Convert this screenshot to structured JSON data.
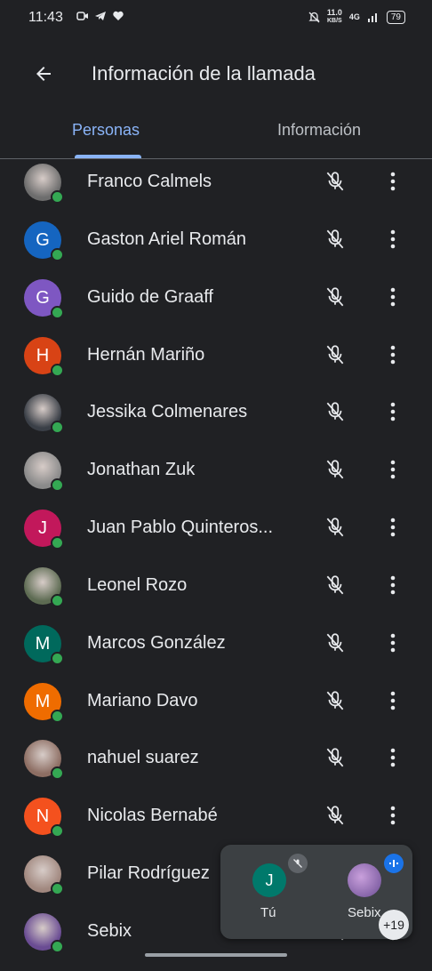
{
  "status_bar": {
    "time": "11:43",
    "net_speed_value": "11.0",
    "net_speed_unit": "KB/S",
    "network": "4G",
    "battery": "79"
  },
  "header": {
    "title": "Información de la llamada"
  },
  "tabs": [
    {
      "label": "Personas",
      "active": true
    },
    {
      "label": "Información",
      "active": false
    }
  ],
  "participants": [
    {
      "name": "Franco Calmels",
      "initial": "",
      "avatar_color": "#6d6d6d",
      "photo": true
    },
    {
      "name": "Gaston Ariel Román",
      "initial": "G",
      "avatar_color": "#1565c0",
      "photo": false
    },
    {
      "name": "Guido de Graaff",
      "initial": "G",
      "avatar_color": "#7e57c2",
      "photo": false
    },
    {
      "name": "Hernán Mariño",
      "initial": "H",
      "avatar_color": "#d84315",
      "photo": false
    },
    {
      "name": "Jessika Colmenares",
      "initial": "",
      "avatar_color": "#3a3f47",
      "photo": true
    },
    {
      "name": "Jonathan Zuk",
      "initial": "",
      "avatar_color": "#8a8a8a",
      "photo": true
    },
    {
      "name": "Juan Pablo Quinteros...",
      "initial": "J",
      "avatar_color": "#c2185b",
      "photo": false
    },
    {
      "name": "Leonel Rozo",
      "initial": "",
      "avatar_color": "#5d6b52",
      "photo": true
    },
    {
      "name": "Marcos González",
      "initial": "M",
      "avatar_color": "#00695c",
      "photo": false
    },
    {
      "name": "Mariano Davo",
      "initial": "M",
      "avatar_color": "#ef6c00",
      "photo": false
    },
    {
      "name": "nahuel suarez",
      "initial": "",
      "avatar_color": "#8d6e63",
      "photo": true
    },
    {
      "name": "Nicolas Bernabé",
      "initial": "N",
      "avatar_color": "#f4511e",
      "photo": false
    },
    {
      "name": "Pilar Rodríguez",
      "initial": "",
      "avatar_color": "#a1887f",
      "photo": true
    },
    {
      "name": "Sebix",
      "initial": "",
      "avatar_color": "#6a4c93",
      "photo": true
    }
  ],
  "pip": {
    "self_initial": "J",
    "self_label": "Tú",
    "self_color": "#00796b",
    "other_label": "Sebix",
    "more_count": "+19"
  },
  "colors": {
    "accent": "#8ab4f8",
    "online": "#34a853",
    "background": "#202124"
  }
}
